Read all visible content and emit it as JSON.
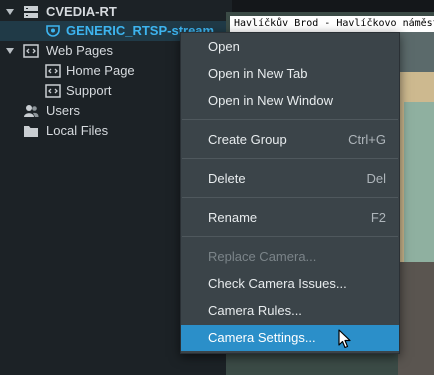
{
  "tree": {
    "server": "CVEDIA-RT",
    "camera": "GENERIC_RTSP-stream",
    "web_pages": "Web Pages",
    "home_page": "Home Page",
    "support": "Support",
    "users": "Users",
    "local_files": "Local Files"
  },
  "view": {
    "banner": "Havlíčkův Brod - Havlíčkovo náměstí"
  },
  "menu": {
    "open": "Open",
    "open_new_tab": "Open in New Tab",
    "open_new_window": "Open in New Window",
    "create_group": "Create Group",
    "create_group_shortcut": "Ctrl+G",
    "delete": "Delete",
    "delete_shortcut": "Del",
    "rename": "Rename",
    "rename_shortcut": "F2",
    "replace_camera": "Replace Camera...",
    "check_camera_issues": "Check Camera Issues...",
    "camera_rules": "Camera Rules...",
    "camera_settings": "Camera Settings..."
  },
  "colors": {
    "accent": "#2b8fc9",
    "selected_text": "#3db4ef",
    "menu_bg": "#3b4449"
  }
}
